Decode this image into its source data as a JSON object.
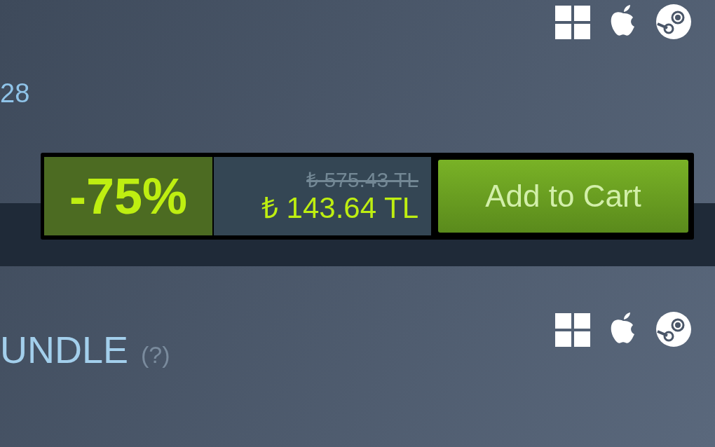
{
  "top_item": {
    "release_fragment": "28"
  },
  "purchase": {
    "discount": "-75%",
    "original_price": "₺ 575.43 TL",
    "final_price": "₺ 143.64 TL",
    "button": "Add to Cart"
  },
  "bottom_item": {
    "title_fragment": "UNDLE",
    "help": "(?)"
  }
}
